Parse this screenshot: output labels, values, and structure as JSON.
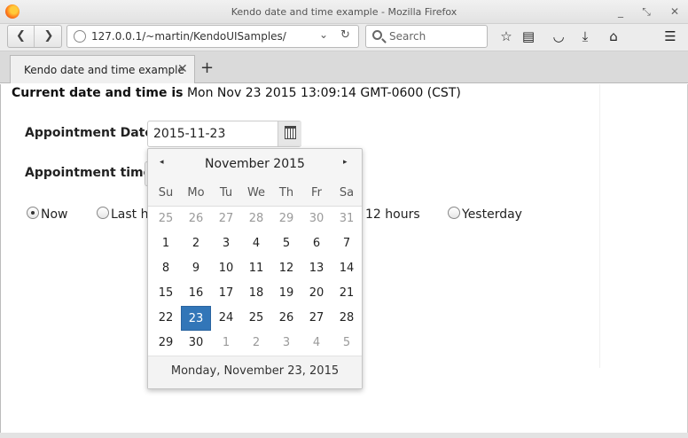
{
  "window": {
    "title": "Kendo date and time example - Mozilla Firefox"
  },
  "toolbar": {
    "url": "127.0.0.1/~martin/KendoUISamples/",
    "search_placeholder": "Search"
  },
  "tabs": [
    {
      "label": "Kendo date and time example",
      "active": true
    }
  ],
  "page": {
    "current_label": "Current date and time is",
    "current_value": "Mon Nov 23 2015 13:09:14 GMT-0600 (CST)",
    "appointment_date_label": "Appointment Date:",
    "appointment_date_value": "2015-11-23",
    "appointment_time_label": "Appointment time:",
    "radios": [
      {
        "label": "Now",
        "checked": true
      },
      {
        "label": "Last h",
        "checked": false
      },
      {
        "label": "12 hours",
        "checked": false
      },
      {
        "label": "Yesterday",
        "checked": false
      }
    ]
  },
  "calendar": {
    "prev_glyph": "◂",
    "next_glyph": "▸",
    "month_title": "November 2015",
    "weekdays": [
      "Su",
      "Mo",
      "Tu",
      "We",
      "Th",
      "Fr",
      "Sa"
    ],
    "weeks": [
      [
        {
          "d": "25",
          "other": true
        },
        {
          "d": "26",
          "other": true
        },
        {
          "d": "27",
          "other": true
        },
        {
          "d": "28",
          "other": true
        },
        {
          "d": "29",
          "other": true
        },
        {
          "d": "30",
          "other": true
        },
        {
          "d": "31",
          "other": true
        }
      ],
      [
        {
          "d": "1"
        },
        {
          "d": "2"
        },
        {
          "d": "3"
        },
        {
          "d": "4"
        },
        {
          "d": "5"
        },
        {
          "d": "6"
        },
        {
          "d": "7"
        }
      ],
      [
        {
          "d": "8"
        },
        {
          "d": "9"
        },
        {
          "d": "10"
        },
        {
          "d": "11"
        },
        {
          "d": "12"
        },
        {
          "d": "13"
        },
        {
          "d": "14"
        }
      ],
      [
        {
          "d": "15"
        },
        {
          "d": "16"
        },
        {
          "d": "17"
        },
        {
          "d": "18"
        },
        {
          "d": "19"
        },
        {
          "d": "20"
        },
        {
          "d": "21"
        }
      ],
      [
        {
          "d": "22"
        },
        {
          "d": "23",
          "selected": true
        },
        {
          "d": "24"
        },
        {
          "d": "25"
        },
        {
          "d": "26"
        },
        {
          "d": "27"
        },
        {
          "d": "28"
        }
      ],
      [
        {
          "d": "29"
        },
        {
          "d": "30"
        },
        {
          "d": "1",
          "other": true
        },
        {
          "d": "2",
          "other": true
        },
        {
          "d": "3",
          "other": true
        },
        {
          "d": "4",
          "other": true
        },
        {
          "d": "5",
          "other": true
        }
      ]
    ],
    "footer": "Monday, November 23, 2015"
  },
  "colors": {
    "selected_day": "#3276b8",
    "other_month_day": "#9a9a9a"
  },
  "icons": {
    "window_controls": [
      "minimize-icon",
      "maximize-icon",
      "close-icon"
    ],
    "toolbar": [
      "bookmark-star-icon",
      "reading-list-icon",
      "pocket-icon",
      "download-icon",
      "home-icon",
      "menu-icon"
    ]
  }
}
